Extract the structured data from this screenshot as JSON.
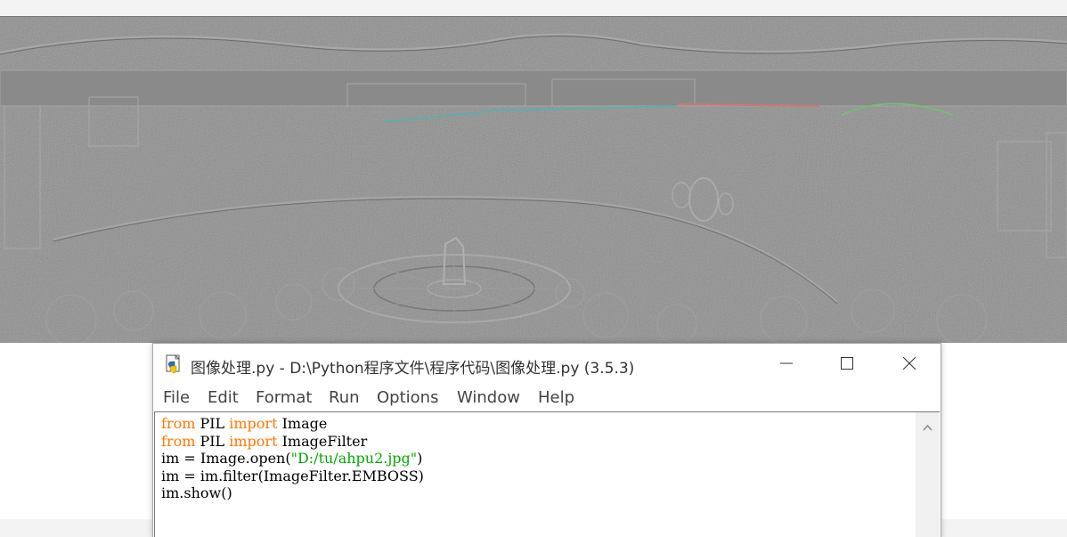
{
  "window": {
    "title": "图像处理.py - D:\\Python程序文件\\程序代码\\图像处理.py (3.5.3)"
  },
  "menu": {
    "items": [
      "File",
      "Edit",
      "Format",
      "Run",
      "Options",
      "Window",
      "Help"
    ]
  },
  "code": {
    "line1": {
      "kw1": "from",
      "mod": " PIL ",
      "kw2": "import",
      "name": " Image"
    },
    "line2": {
      "kw1": "from",
      "mod": " PIL ",
      "kw2": "import",
      "name": " ImageFilter"
    },
    "line3": {
      "pre": "im = Image.open(",
      "str": "\"D:/tu/ahpu2.jpg\"",
      "post": ")"
    },
    "line4": "im = im.filter(ImageFilter.EMBOSS)",
    "line5": "im.show()"
  },
  "colors": {
    "keyword": "#ff7700",
    "string": "#00aa00",
    "emboss_gray": "#8c8c8c"
  },
  "icons": [
    "python-file-icon",
    "minimize-icon",
    "maximize-icon",
    "close-icon",
    "scroll-up-icon"
  ]
}
